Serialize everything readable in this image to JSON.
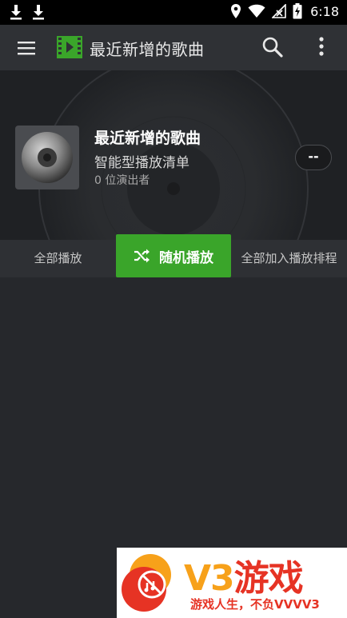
{
  "status_bar": {
    "time": "6:18",
    "left_icons": [
      "download-icon",
      "download-icon"
    ],
    "right_icons": [
      "location-icon",
      "wifi-icon",
      "no-signal-icon",
      "battery-charging-icon"
    ]
  },
  "toolbar": {
    "title": "最近新增的歌曲",
    "menu_icon": "hamburger-menu-icon",
    "app_icon": "playlist-film-icon",
    "search_icon": "search-icon",
    "overflow_icon": "more-vert-icon"
  },
  "playlist": {
    "title": "最近新增的歌曲",
    "subtitle": "智能型播放清单",
    "artist_count": "0 位演出者",
    "more_label": "--"
  },
  "actions": {
    "play_all": "全部播放",
    "shuffle": "随机播放",
    "queue_all": "全部加入播放排程"
  },
  "watermark": {
    "brand_a": "V3",
    "brand_b": "游戏",
    "tagline": "游戏人生，不负VVVV3"
  },
  "colors": {
    "accent": "#3aa52a",
    "toolbar_bg": "#2f3135",
    "header_bg": "#1f2124",
    "content_bg": "#26282c",
    "watermark_orange": "#f7a11a",
    "watermark_red": "#e63324"
  }
}
